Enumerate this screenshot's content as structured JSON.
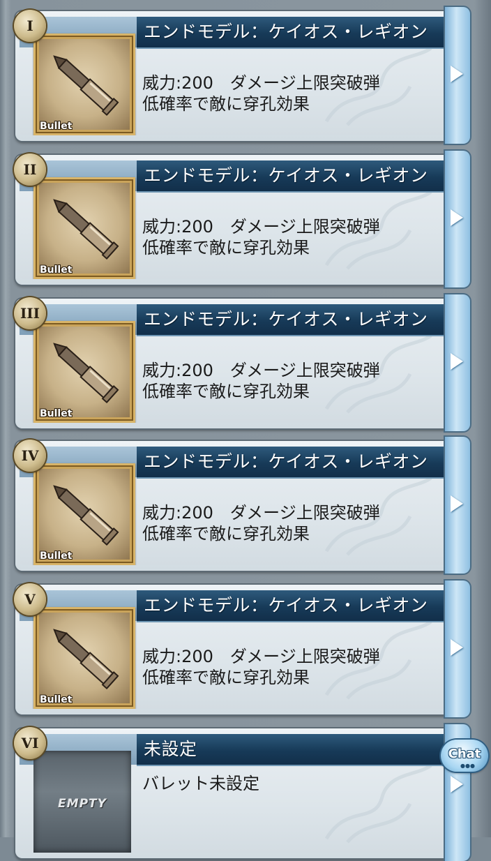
{
  "slots": [
    {
      "number": "I",
      "name": "エンドモデル：ケイオス・レギオン",
      "desc_line1": "威力:200　ダメージ上限突破弾",
      "desc_line2": "低確率で敵に穿孔効果",
      "thumb_label": "Bullet",
      "empty": false
    },
    {
      "number": "II",
      "name": "エンドモデル：ケイオス・レギオン",
      "desc_line1": "威力:200　ダメージ上限突破弾",
      "desc_line2": "低確率で敵に穿孔効果",
      "thumb_label": "Bullet",
      "empty": false
    },
    {
      "number": "III",
      "name": "エンドモデル：ケイオス・レギオン",
      "desc_line1": "威力:200　ダメージ上限突破弾",
      "desc_line2": "低確率で敵に穿孔効果",
      "thumb_label": "Bullet",
      "empty": false
    },
    {
      "number": "IV",
      "name": "エンドモデル：ケイオス・レギオン",
      "desc_line1": "威力:200　ダメージ上限突破弾",
      "desc_line2": "低確率で敵に穿孔効果",
      "thumb_label": "Bullet",
      "empty": false
    },
    {
      "number": "V",
      "name": "エンドモデル：ケイオス・レギオン",
      "desc_line1": "威力:200　ダメージ上限突破弾",
      "desc_line2": "低確率で敵に穿孔効果",
      "thumb_label": "Bullet",
      "empty": false
    },
    {
      "number": "VI",
      "name": "未設定",
      "desc_line1": "バレット未設定",
      "desc_line2": "",
      "thumb_label": "EMPTY",
      "empty": true
    }
  ],
  "chat_button": {
    "label": "Chat"
  },
  "icons": {
    "slot_arrow": "chevron-right-icon",
    "bullet_art": "bullet-icon"
  },
  "colors": {
    "name_bar": "#173a58",
    "frame_gold": "#caa45a",
    "side_tab": "#8fc0e2"
  }
}
